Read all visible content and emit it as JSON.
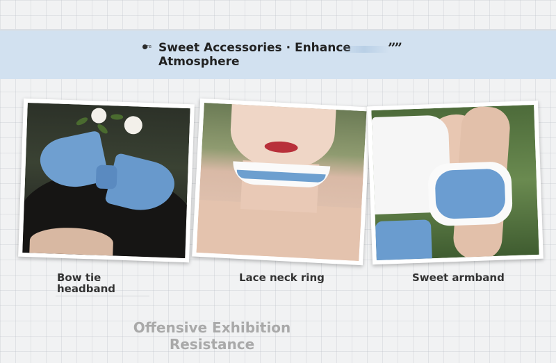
{
  "banner": {
    "icon": "quote-open-icon",
    "icon_glyph": "re",
    "title": "Sweet Accessories · Enhance Atmosphere",
    "quote_close": "””"
  },
  "products": [
    {
      "caption": "Bow tie headband",
      "image": "blue-bow-headband-photo"
    },
    {
      "caption": "Lace neck ring",
      "image": "lace-choker-photo"
    },
    {
      "caption": "Sweet armband",
      "image": "ruffle-armband-photo"
    }
  ],
  "footer": {
    "text": "Offensive Exhibition Resistance"
  },
  "colors": {
    "banner_bg": "#d2e1f0",
    "accent_blue": "#6f9fd0",
    "footer_text": "#a9a9a9"
  }
}
